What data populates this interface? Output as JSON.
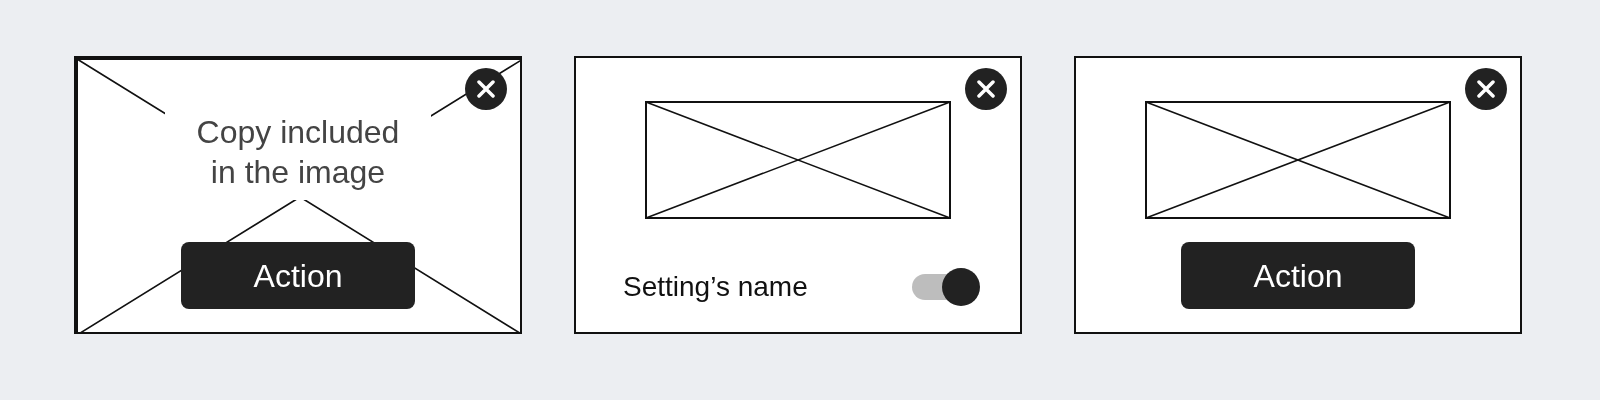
{
  "cards": [
    {
      "kind": "image_overlay",
      "copy_lines": [
        "Copy included",
        "in the image"
      ],
      "action": "Action"
    },
    {
      "kind": "setting",
      "setting": {
        "label": "Setting’s name",
        "on": true
      }
    },
    {
      "kind": "image_action",
      "action": "Action"
    }
  ]
}
